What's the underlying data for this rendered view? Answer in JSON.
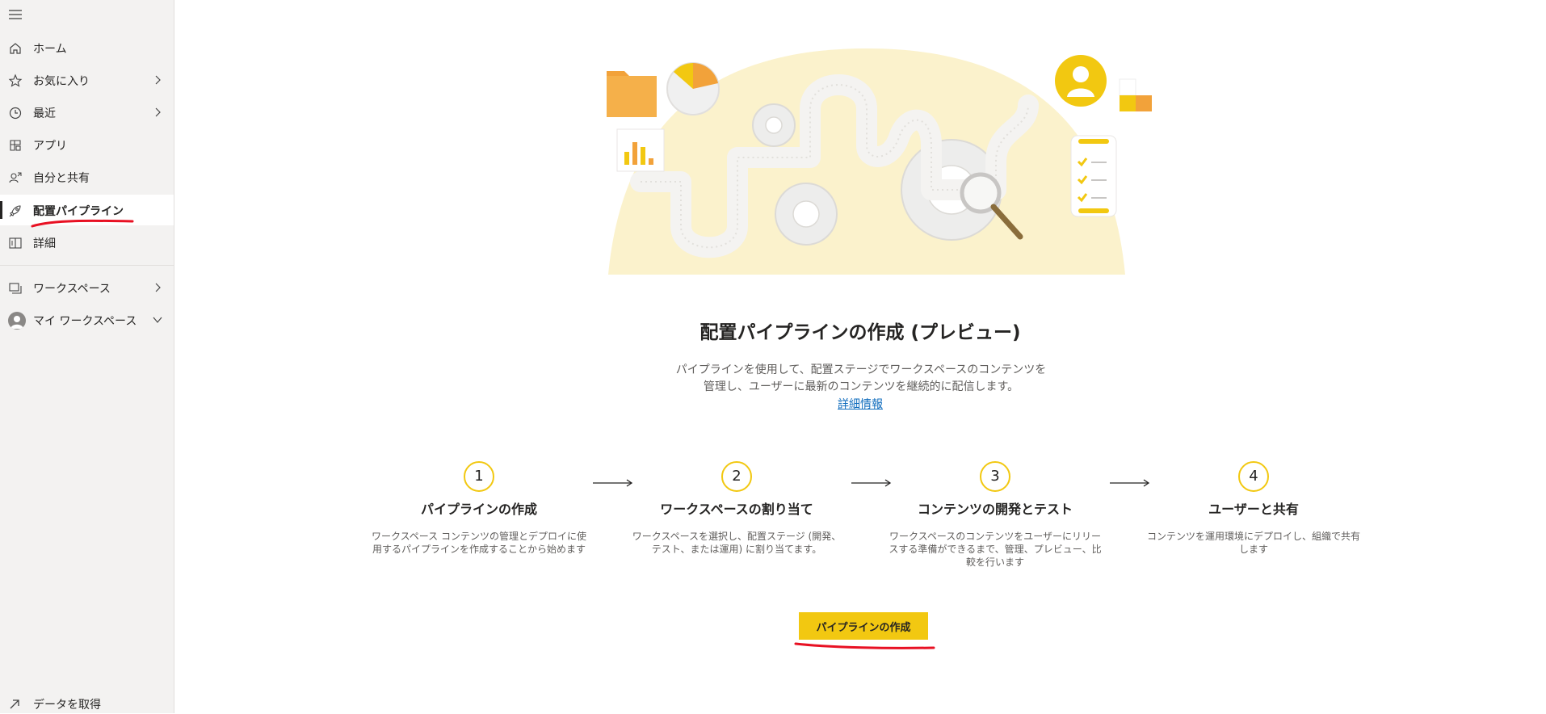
{
  "sidebar": {
    "items": [
      {
        "label": "ホーム",
        "icon": "home-icon"
      },
      {
        "label": "お気に入り",
        "icon": "star-icon"
      },
      {
        "label": "最近",
        "icon": "clock-icon"
      },
      {
        "label": "アプリ",
        "icon": "apps-icon"
      },
      {
        "label": "自分と共有",
        "icon": "shared-with-me-icon"
      },
      {
        "label": "配置パイプライン",
        "icon": "rocket-icon"
      },
      {
        "label": "詳細",
        "icon": "book-icon"
      }
    ],
    "workspaces_label": "ワークスペース",
    "my_workspace_label": "マイ ワークスペース",
    "get_data_label": "データを取得"
  },
  "main": {
    "title": "配置パイプラインの作成 (プレビュー)",
    "description_line1": "パイプラインを使用して、配置ステージでワークスペースのコンテンツを",
    "description_line2": "管理し、ユーザーに最新のコンテンツを継続的に配信します。",
    "learn_more": "詳細情報",
    "steps": [
      {
        "number": "1",
        "title": "パイプラインの作成",
        "desc_lines": [
          "ワークスペース コンテンツの管理とデプロイに使",
          "用するパイプラインを作成することから始めます"
        ]
      },
      {
        "number": "2",
        "title": "ワークスペースの割り当て",
        "desc_lines": [
          "ワークスペースを選択し、配置ステージ (開発、",
          "テスト、または運用) に割り当てます。"
        ]
      },
      {
        "number": "3",
        "title": "コンテンツの開発とテスト",
        "desc_lines": [
          "ワークスペースのコンテンツをユーザーにリリー",
          "スする準備ができるまで、管理、プレビュー、比",
          "較を行います"
        ]
      },
      {
        "number": "4",
        "title": "ユーザーと共有",
        "desc_lines": [
          "コンテンツを運用環境にデプロイし、組織で共有",
          "します"
        ]
      }
    ],
    "create_button": "パイプラインの作成"
  },
  "colors": {
    "accent": "#f2c811",
    "annotation_red": "#e81123",
    "link": "#0f6cbd",
    "sidebar_bg": "#f3f2f1"
  }
}
